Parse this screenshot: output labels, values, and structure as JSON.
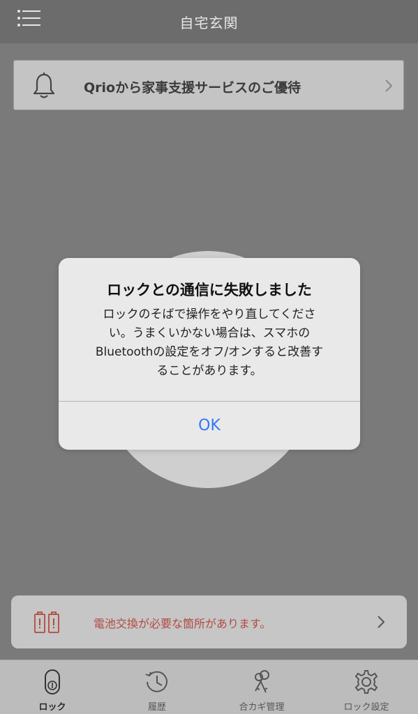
{
  "header": {
    "title": "自宅玄関",
    "menu_icon": "menu-icon"
  },
  "promo": {
    "text": "Qrioから家事支援サービスのご優待",
    "icon": "bell-icon"
  },
  "dialog": {
    "title": "ロックとの通信に失敗しました",
    "message_lines": [
      "ロックのそばで操作をやり直してくださ",
      "い。うまくいかない場合は、スマホの",
      "Bluetoothの設定をオフ/オンすると改善す",
      "ることがあります。"
    ],
    "ok_label": "OK",
    "ok_color": "#3478f6"
  },
  "battery_notice": {
    "text": "電池交換が必要な箇所があります。",
    "text_color": "#b34a42",
    "icon": "battery-warning-icon"
  },
  "tabs": [
    {
      "label": "ロック",
      "icon": "lock-icon",
      "active": true
    },
    {
      "label": "履歴",
      "icon": "history-icon",
      "active": false
    },
    {
      "label": "合カギ管理",
      "icon": "keys-icon",
      "active": false
    },
    {
      "label": "ロック設定",
      "icon": "gear-icon",
      "active": false
    }
  ]
}
